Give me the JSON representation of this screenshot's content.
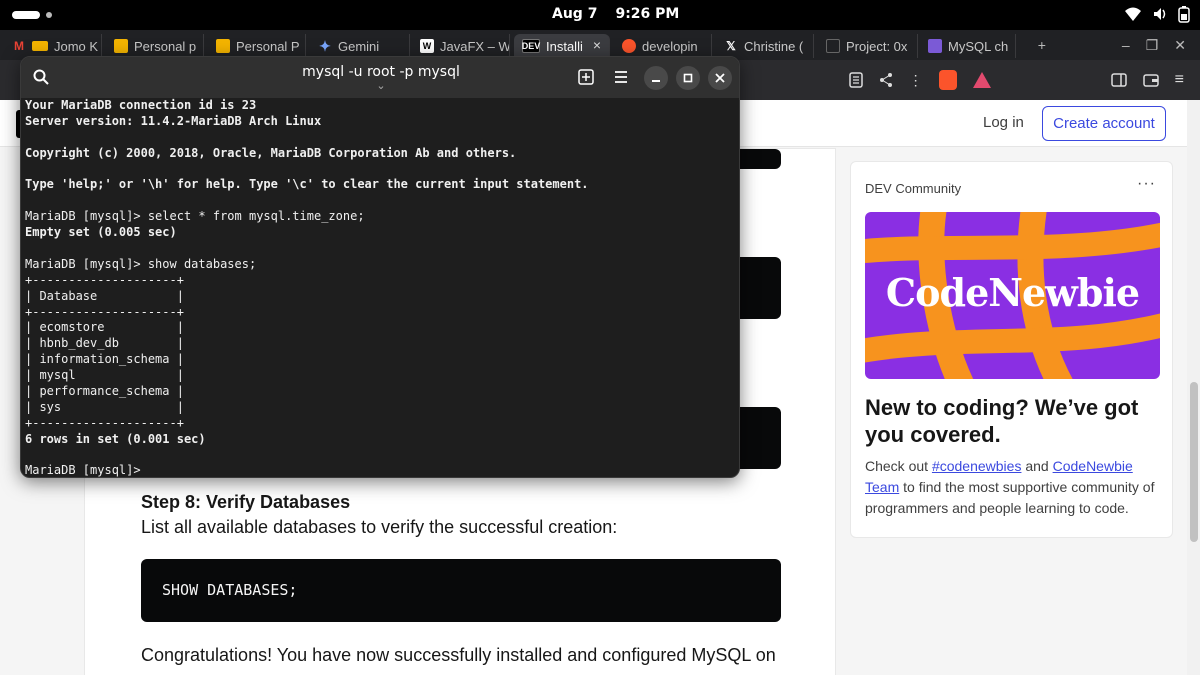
{
  "system_bar": {
    "date": "Aug 7",
    "time": "9:26 PM"
  },
  "browser": {
    "tabs": [
      {
        "label": "Jomo K",
        "favicon": "gmail-icon"
      },
      {
        "label": "Personal p",
        "favicon": "slides-icon"
      },
      {
        "label": "Personal P",
        "favicon": "slides-icon"
      },
      {
        "label": "Gemini",
        "favicon": "gemini-icon"
      },
      {
        "label": "JavaFX – W",
        "favicon": "wikipedia-icon"
      },
      {
        "label": "Installi",
        "favicon": "dev-icon",
        "active": true
      },
      {
        "label": "developin",
        "favicon": "brave-search-icon"
      },
      {
        "label": "Christine (",
        "favicon": "x-icon"
      },
      {
        "label": "Project: 0x",
        "favicon": "project-icon"
      },
      {
        "label": "MySQL ch",
        "favicon": "mysql-icon"
      }
    ],
    "favicon_colors": {
      "gmail": "#ea4335",
      "slides": "#f4b400",
      "dev": "#000000",
      "brave": "#fb542b",
      "mysql": "#7b5ad6"
    }
  },
  "site": {
    "login_label": "Log in",
    "create_account_label": "Create account",
    "accent_color": "#3b49df"
  },
  "article": {
    "step_title": "Step 8: Verify Databases",
    "step_desc": "List all available databases to verify the successful creation:",
    "code": "SHOW DATABASES;",
    "paragraph": "Congratulations! You have now successfully installed and configured MySQL on"
  },
  "sidebar": {
    "header": "DEV Community",
    "more_label": "···",
    "banner_text": "CodeNewbie",
    "title": "New to coding? We’ve got you covered.",
    "body_prefix": "Check out ",
    "link1": "#codenewbies",
    "body_mid": " and ",
    "link2": "CodeNewbie Team",
    "body_suffix": " to find the most supportive community of programmers and people learning to code."
  },
  "terminal": {
    "title": "mysql -u root -p mysql",
    "subtitle": "⌄",
    "lines": [
      {
        "text": "Your MariaDB connection id is 23",
        "bold": true
      },
      {
        "text": "Server version: 11.4.2-MariaDB Arch Linux",
        "bold": true
      },
      {
        "text": "",
        "bold": false
      },
      {
        "text": "Copyright (c) 2000, 2018, Oracle, MariaDB Corporation Ab and others.",
        "bold": true
      },
      {
        "text": "",
        "bold": false
      },
      {
        "text": "Type 'help;' or '\\h' for help. Type '\\c' to clear the current input statement.",
        "bold": true
      },
      {
        "text": "",
        "bold": false
      },
      {
        "text": "MariaDB [mysql]> select * from mysql.time_zone;",
        "bold": false
      },
      {
        "text": "Empty set (0.005 sec)",
        "bold": true
      },
      {
        "text": "",
        "bold": false
      },
      {
        "text": "MariaDB [mysql]> show databases;",
        "bold": false
      },
      {
        "text": "+--------------------+",
        "bold": false
      },
      {
        "text": "| Database           |",
        "bold": false
      },
      {
        "text": "+--------------------+",
        "bold": false
      },
      {
        "text": "| ecomstore          |",
        "bold": false
      },
      {
        "text": "| hbnb_dev_db        |",
        "bold": false
      },
      {
        "text": "| information_schema |",
        "bold": false
      },
      {
        "text": "| mysql              |",
        "bold": false
      },
      {
        "text": "| performance_schema |",
        "bold": false
      },
      {
        "text": "| sys                |",
        "bold": false
      },
      {
        "text": "+--------------------+",
        "bold": false
      },
      {
        "text": "6 rows in set (0.001 sec)",
        "bold": true
      },
      {
        "text": "",
        "bold": false
      },
      {
        "text": "MariaDB [mysql]>",
        "bold": false
      }
    ]
  }
}
